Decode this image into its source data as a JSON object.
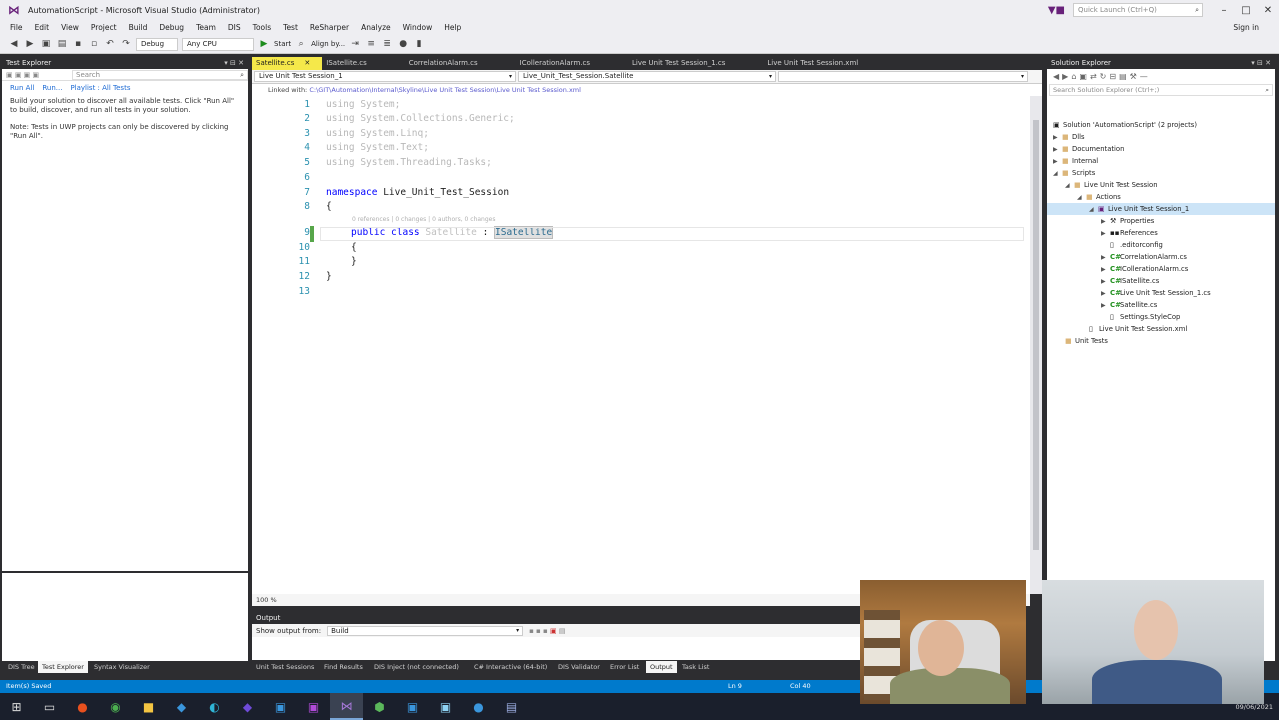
{
  "window": {
    "title": "AutomationScript - Microsoft Visual Studio (Administrator)",
    "quick_launch": "Quick Launch (Ctrl+Q)",
    "sign_in": "Sign in"
  },
  "menu": [
    "File",
    "Edit",
    "View",
    "Project",
    "Build",
    "Debug",
    "Team",
    "DIS",
    "Tools",
    "Test",
    "ReSharper",
    "Analyze",
    "Window",
    "Help"
  ],
  "toolbar": {
    "config": "Debug",
    "platform": "Any CPU",
    "start": "Start",
    "align": "Align by..."
  },
  "test_explorer": {
    "title": "Test Explorer",
    "search_placeholder": "Search",
    "run_all": "Run All",
    "run": "Run...",
    "playlist": "Playlist : All Tests",
    "message1": "Build your solution to discover all available tests. Click \"Run All\" to build, discover, and run all tests in your solution.",
    "message2": "Note: Tests in UWP projects can only be discovered by clicking \"Run All\"."
  },
  "editor": {
    "tabs": [
      "Satellite.cs",
      "ISatellite.cs",
      "CorrelationAlarm.cs",
      "ICollerationAlarm.cs",
      "Live Unit Test Session_1.cs",
      "Live Unit Test Session.xml"
    ],
    "nav_project": "Live Unit Test Session_1",
    "nav_member": "Live_Unit_Test_Session.Satellite",
    "linked_label": "Linked with:",
    "linked_path": "C:\\GIT\\Automation\\Internal\\Skyline\\Live Unit Test Session\\Live Unit Test Session.xml",
    "codelens": "0 references | 0 changes | 0 authors, 0 changes",
    "zoom": "100 %",
    "lines": {
      "l1": "using System;",
      "l2": "using System.Collections.Generic;",
      "l3": "using System.Linq;",
      "l4": "using System.Text;",
      "l5": "using System.Threading.Tasks;",
      "l7_kw": "namespace",
      "l7_name": " Live_Unit_Test_Session",
      "l8": "{",
      "l9_kw": "public class",
      "l9_type": " Satellite",
      "l9_colon": " : ",
      "l9_iface": "ISatellite",
      "l10": "{",
      "l11": "}",
      "l12": "}"
    },
    "line_numbers": [
      "1",
      "2",
      "3",
      "4",
      "5",
      "6",
      "7",
      "8",
      "9",
      "10",
      "11",
      "12",
      "13"
    ]
  },
  "solution_explorer": {
    "title": "Solution Explorer",
    "search_placeholder": "Search Solution Explorer (Ctrl+;)",
    "nodes": [
      "Solution 'AutomationScript' (2 projects)",
      "Dlls",
      "Documentation",
      "Internal",
      "Scripts",
      "Live Unit Test Session",
      "Actions",
      "Live Unit Test Session_1",
      "Properties",
      "References",
      ".editorconfig",
      "CorrelationAlarm.cs",
      "ICollerationAlarm.cs",
      "ISatellite.cs",
      "Live Unit Test Session_1.cs",
      "Satellite.cs",
      "Settings.StyleCop",
      "Live Unit Test Session.xml",
      "Unit Tests"
    ]
  },
  "output": {
    "title": "Output",
    "show_from_label": "Show output from:",
    "source": "Build"
  },
  "bottom_tabs_left": [
    "DIS Tree",
    "Test Explorer",
    "Syntax Visualizer"
  ],
  "bottom_tabs_center": [
    "Unit Test Sessions",
    "Find Results",
    "DIS Inject (not connected)",
    "C# Interactive (64-bit)",
    "DIS Validator",
    "Error List",
    "Output",
    "Task List"
  ],
  "status": {
    "left": "Item(s) Saved",
    "line": "Ln 9",
    "col": "Col 40"
  },
  "taskbar": {
    "date": "09/06/2021"
  },
  "colors": {
    "accent": "#007acc",
    "active_tab": "#f5e84a",
    "dark_chrome": "#2d2d30"
  }
}
